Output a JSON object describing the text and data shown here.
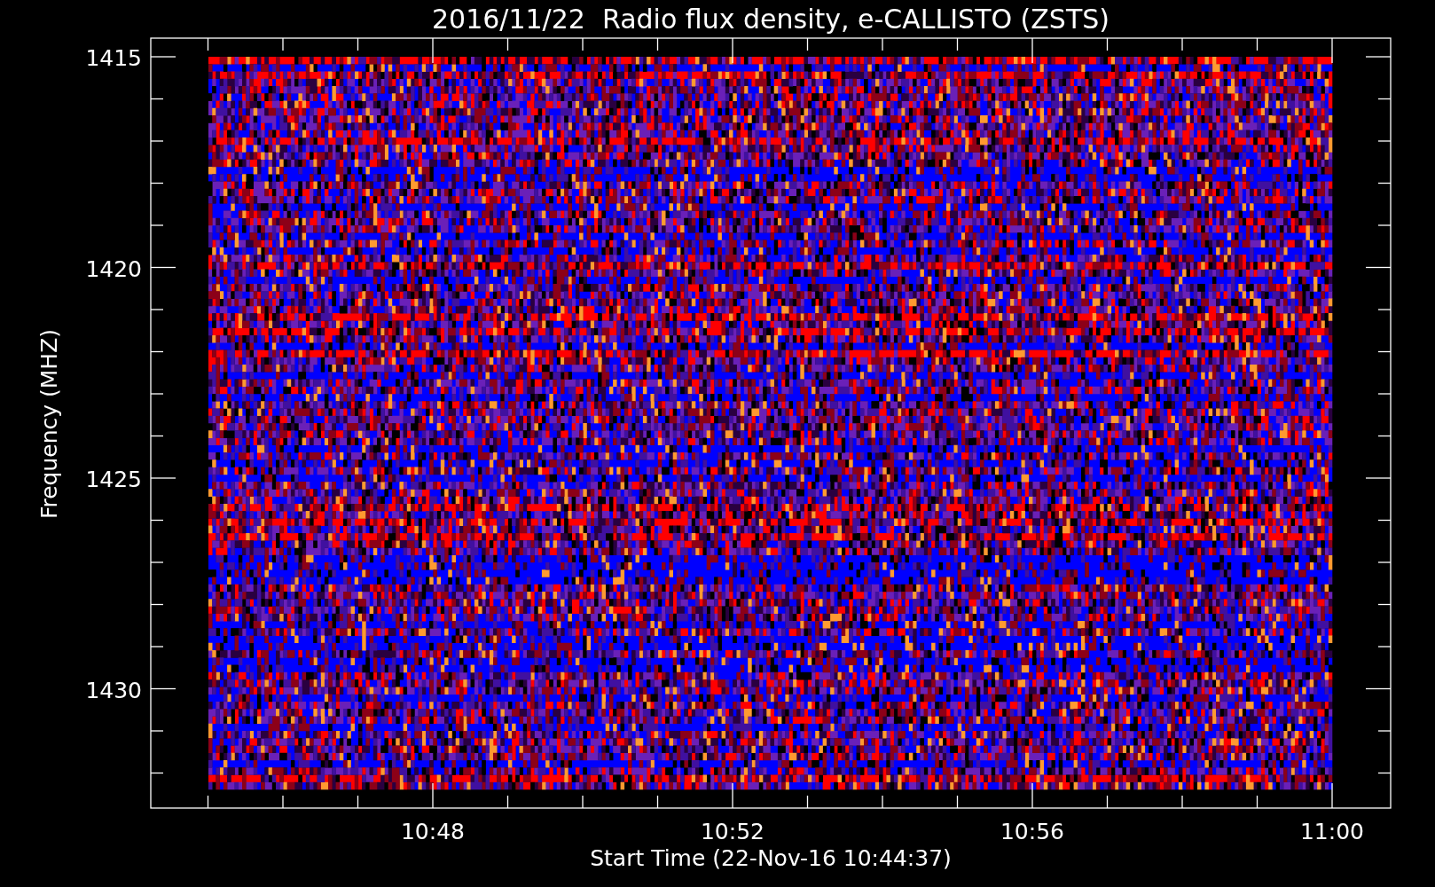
{
  "title": "2016/11/22  Radio flux density, e-CALLISTO (ZSTS)",
  "y_axis": {
    "label": "Frequency (MHZ)",
    "ticks": [
      "1415",
      "1420",
      "1425",
      "1430"
    ]
  },
  "x_axis": {
    "label": "Start Time (22-Nov-16 10:44:37)",
    "ticks": [
      "10:48",
      "10:52",
      "10:56",
      "11:00"
    ]
  }
}
